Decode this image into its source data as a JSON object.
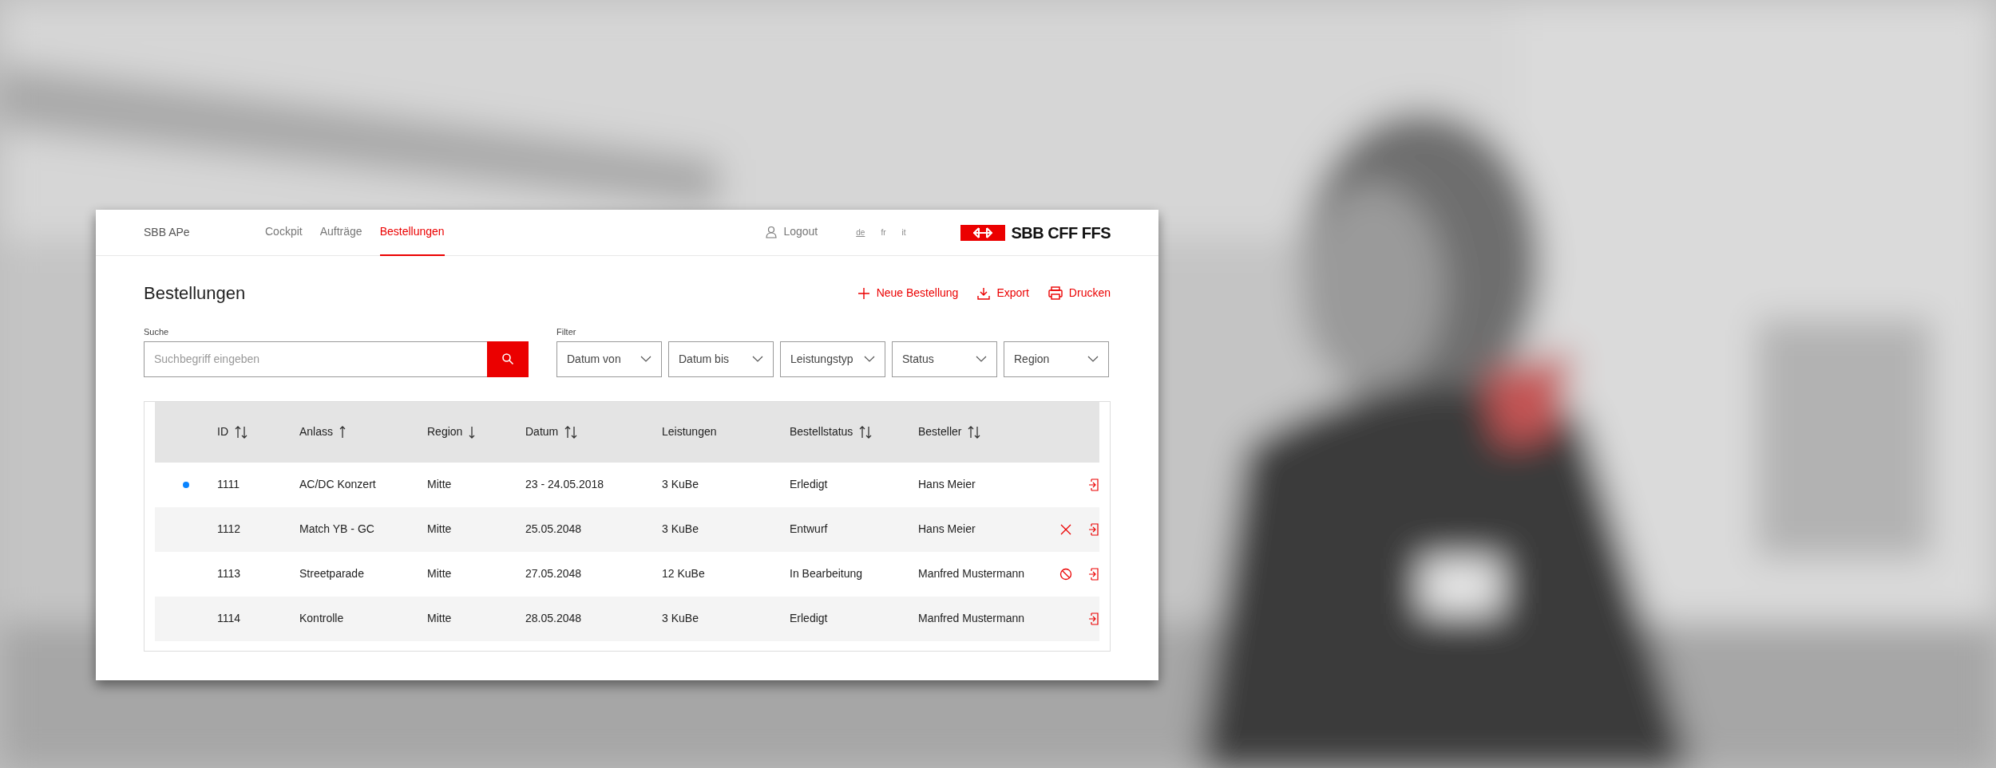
{
  "header": {
    "app_name": "SBB APe",
    "nav": [
      {
        "label": "Cockpit",
        "selected": false
      },
      {
        "label": "Aufträge",
        "selected": false
      },
      {
        "label": "Bestellungen",
        "selected": true
      }
    ],
    "logout": "Logout",
    "languages": [
      {
        "label": "de",
        "selected": true
      },
      {
        "label": "fr",
        "selected": false
      },
      {
        "label": "it",
        "selected": false
      }
    ],
    "logo_text": "SBB CFF FFS"
  },
  "page_title": "Bestellungen",
  "actions": [
    {
      "kind": "add",
      "label": "Neue Bestellung"
    },
    {
      "kind": "export",
      "label": "Export"
    },
    {
      "kind": "print",
      "label": "Drucken"
    }
  ],
  "search": {
    "label": "Suche",
    "placeholder": "Suchbegriff eingeben"
  },
  "filter": {
    "label": "Filter",
    "selects": [
      "Datum von",
      "Datum bis",
      "Leistungstyp",
      "Status",
      "Region"
    ]
  },
  "table": {
    "columns": [
      {
        "label": "ID",
        "sort_up": true,
        "sort_down": true
      },
      {
        "label": "Anlass",
        "sort_up": true,
        "sort_down": false
      },
      {
        "label": "Region",
        "sort_up": false,
        "sort_down": true
      },
      {
        "label": "Datum",
        "sort_up": true,
        "sort_down": true
      },
      {
        "label": "Leistungen",
        "sort_up": false,
        "sort_down": false
      },
      {
        "label": "Bestellstatus",
        "sort_up": true,
        "sort_down": true
      },
      {
        "label": "Besteller",
        "sort_up": true,
        "sort_down": true
      }
    ],
    "rows": [
      {
        "marked": true,
        "cells": [
          "1111",
          "AC/DC Konzert",
          "Mitte",
          "23 - 24.05.2018",
          "3 KuBe",
          "Erledigt",
          "Hans Meier"
        ],
        "actions": [
          {
            "kind": "open"
          }
        ]
      },
      {
        "marked": false,
        "cells": [
          "1112",
          "Match YB - GC",
          "Mitte",
          "25.05.2048",
          "3 KuBe",
          "Entwurf",
          "Hans Meier"
        ],
        "actions": [
          {
            "kind": "delete"
          },
          {
            "kind": "open"
          }
        ]
      },
      {
        "marked": false,
        "cells": [
          "1113",
          "Streetparade",
          "Mitte",
          "27.05.2048",
          "12 KuBe",
          "In Bearbeitung",
          "Manfred Mustermann"
        ],
        "actions": [
          {
            "kind": "cancel"
          },
          {
            "kind": "open"
          }
        ]
      },
      {
        "marked": false,
        "cells": [
          "1114",
          "Kontrolle",
          "Mitte",
          "28.05.2048",
          "3 KuBe",
          "Erledigt",
          "Manfred Mustermann"
        ],
        "actions": [
          {
            "kind": "open"
          }
        ]
      }
    ]
  }
}
